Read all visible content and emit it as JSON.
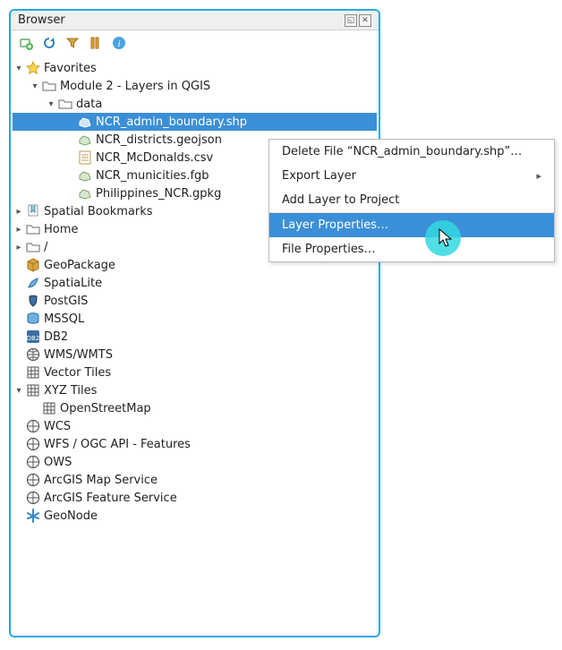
{
  "panel": {
    "title": "Browser"
  },
  "toolbar_icons": [
    "add-layer-icon",
    "refresh-icon",
    "filter-icon",
    "collapse-icon",
    "info-icon"
  ],
  "tree": {
    "favorites": {
      "label": "Favorites",
      "module": {
        "label": "Module 2 - Layers in QGIS",
        "data": {
          "label": "data",
          "files": [
            "NCR_admin_boundary.shp",
            "NCR_districts.geojson",
            "NCR_McDonalds.csv",
            "NCR_municities.fgb",
            "Philippines_NCR.gpkg"
          ]
        }
      }
    },
    "items": [
      "Spatial Bookmarks",
      "Home",
      "/",
      "GeoPackage",
      "SpatiaLite",
      "PostGIS",
      "MSSQL",
      "DB2",
      "WMS/WMTS",
      "Vector Tiles"
    ],
    "xyz": {
      "label": "XYZ Tiles",
      "children": [
        "OpenStreetMap"
      ]
    },
    "tail": [
      "WCS",
      "WFS / OGC API - Features",
      "OWS",
      "ArcGIS Map Service",
      "ArcGIS Feature Service",
      "GeoNode"
    ]
  },
  "context_menu": {
    "delete": "Delete File “NCR_admin_boundary.shp”…",
    "export": "Export Layer",
    "add": "Add Layer to Project",
    "layer_props": "Layer Properties…",
    "file_props": "File Properties…"
  },
  "selected_file_index": 0
}
